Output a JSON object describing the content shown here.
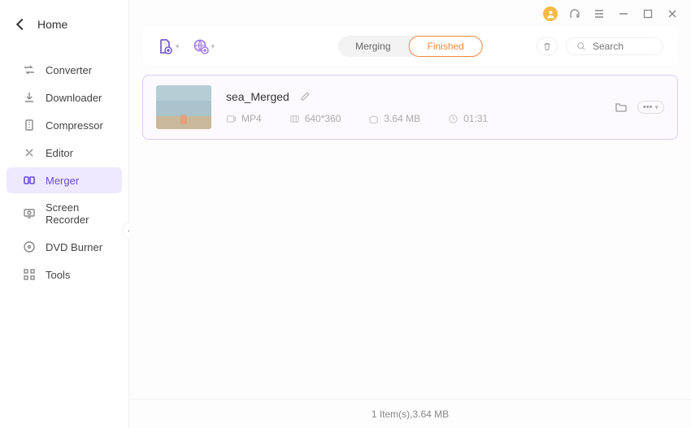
{
  "sidebar": {
    "home_label": "Home",
    "items": [
      {
        "label": "Converter"
      },
      {
        "label": "Downloader"
      },
      {
        "label": "Compressor"
      },
      {
        "label": "Editor"
      },
      {
        "label": "Merger"
      },
      {
        "label": "Screen Recorder"
      },
      {
        "label": "DVD Burner"
      },
      {
        "label": "Tools"
      }
    ],
    "active_index": 4
  },
  "toolbar": {
    "tabs": {
      "merging": "Merging",
      "finished": "Finished"
    },
    "active_tab": "finished",
    "search_placeholder": "Search"
  },
  "item": {
    "name": "sea_Merged",
    "format": "MP4",
    "resolution": "640*360",
    "size": "3.64 MB",
    "duration": "01:31"
  },
  "footer": {
    "summary": "1 Item(s),3.64 MB"
  }
}
